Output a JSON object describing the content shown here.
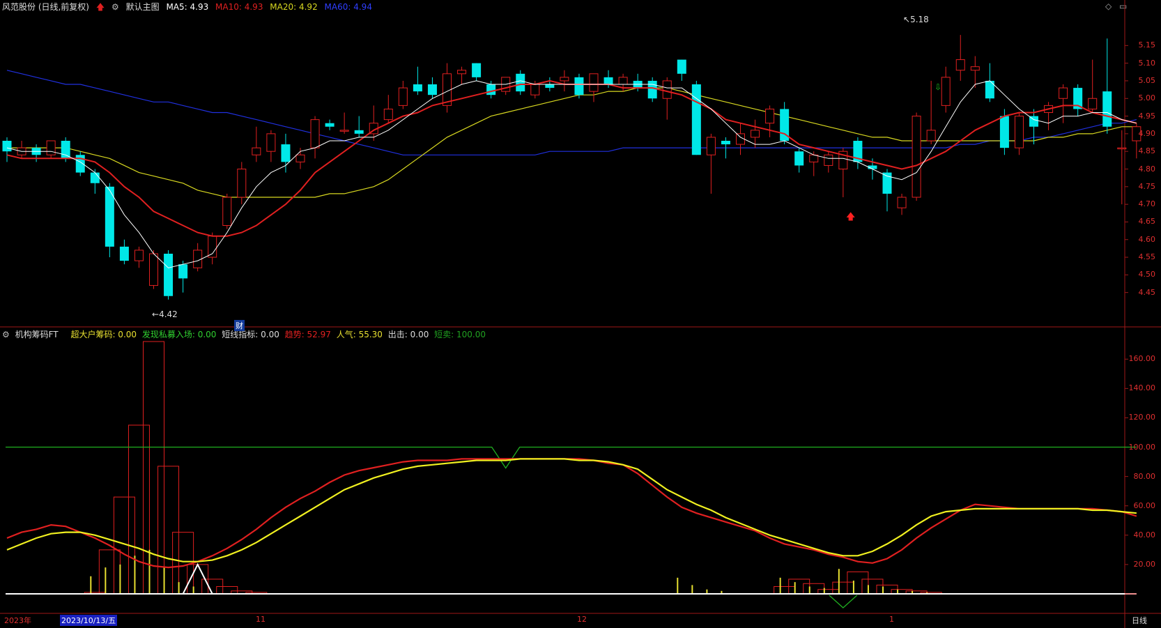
{
  "main_header": {
    "stock": "风范股份 (日线,前复权)",
    "arrow_icon": "up-arrow-icon",
    "settings_icon": "gear-icon",
    "main_chart_label": "默认主图",
    "ma5": "MA5: 4.93",
    "ma10": "MA10: 4.93",
    "ma20": "MA20: 4.92",
    "ma60": "MA60: 4.94"
  },
  "indicator_header": {
    "name": "机构筹码FT",
    "items": [
      {
        "text": "超大户筹码: 0.00",
        "color": "#e8e030"
      },
      {
        "text": "发现私募入场: 0.00",
        "color": "#30d030"
      },
      {
        "text": "短线指标: 0.00",
        "color": "#dddddd"
      },
      {
        "text": "趋势: 52.97",
        "color": "#e02020"
      },
      {
        "text": "人气: 55.30",
        "color": "#e8e030"
      },
      {
        "text": "出击: 0.00",
        "color": "#dddddd"
      },
      {
        "text": "短卖: 100.00",
        "color": "#20a020"
      }
    ]
  },
  "annotations": {
    "high": "5.18",
    "low": "4.42",
    "caiwu": "财"
  },
  "x_axis": {
    "year": "2023年",
    "cursor_date": "2023/10/13/五",
    "m11": "11",
    "m12": "12",
    "m1": "1",
    "period": "日线"
  },
  "colors": {
    "up": "#e02020",
    "down": "#00e8e8",
    "ma5": "#ffffff",
    "ma10": "#e02020",
    "ma20": "#d8d820",
    "ma60": "#2030e0"
  },
  "chart_data": [
    {
      "type": "candlestick",
      "title": "风范股份 (日线,前复权)",
      "y_ticks": [
        "5.15",
        "5.10",
        "5.05",
        "5.00",
        "4.95",
        "4.90",
        "4.85",
        "4.80",
        "4.75",
        "4.70",
        "4.65",
        "4.60",
        "4.55",
        "4.50",
        "4.45"
      ],
      "ylim": [
        4.4,
        5.2
      ],
      "candles": [
        [
          4.88,
          4.85,
          4.89,
          4.82
        ],
        [
          4.84,
          4.86,
          4.88,
          4.83
        ],
        [
          4.86,
          4.84,
          4.87,
          4.82
        ],
        [
          4.84,
          4.88,
          4.88,
          4.83
        ],
        [
          4.88,
          4.83,
          4.89,
          4.82
        ],
        [
          4.84,
          4.79,
          4.85,
          4.78
        ],
        [
          4.79,
          4.76,
          4.8,
          4.73
        ],
        [
          4.75,
          4.58,
          4.76,
          4.55
        ],
        [
          4.58,
          4.54,
          4.6,
          4.53
        ],
        [
          4.54,
          4.57,
          4.58,
          4.52
        ],
        [
          4.47,
          4.56,
          4.57,
          4.46
        ],
        [
          4.56,
          4.44,
          4.57,
          4.43
        ],
        [
          4.53,
          4.49,
          4.54,
          4.45
        ],
        [
          4.52,
          4.57,
          4.59,
          4.51
        ],
        [
          4.55,
          4.61,
          4.62,
          4.53
        ],
        [
          4.64,
          4.72,
          4.73,
          4.63
        ],
        [
          4.72,
          4.8,
          4.82,
          4.7
        ],
        [
          4.84,
          4.86,
          4.92,
          4.82
        ],
        [
          4.85,
          4.9,
          4.91,
          4.82
        ],
        [
          4.87,
          4.82,
          4.9,
          4.79
        ],
        [
          4.82,
          4.84,
          4.86,
          4.8
        ],
        [
          4.86,
          4.94,
          4.95,
          4.83
        ],
        [
          4.93,
          4.92,
          4.94,
          4.91
        ],
        [
          4.91,
          4.91,
          4.96,
          4.9
        ],
        [
          4.91,
          4.9,
          4.95,
          4.89
        ],
        [
          4.9,
          4.93,
          4.98,
          4.88
        ],
        [
          4.94,
          4.97,
          5.01,
          4.93
        ],
        [
          4.98,
          5.03,
          5.05,
          4.97
        ],
        [
          5.04,
          5.02,
          5.09,
          5.01
        ],
        [
          5.04,
          5.01,
          5.06,
          5.0
        ],
        [
          4.98,
          5.07,
          5.1,
          4.96
        ],
        [
          5.07,
          5.08,
          5.09,
          5.04
        ],
        [
          5.1,
          5.06,
          5.1,
          5.05
        ],
        [
          5.04,
          5.01,
          5.05,
          5.0
        ],
        [
          5.02,
          5.06,
          5.06,
          5.01
        ],
        [
          5.07,
          5.02,
          5.08,
          5.01
        ],
        [
          5.01,
          5.04,
          5.05,
          5.0
        ],
        [
          5.04,
          5.03,
          5.06,
          5.02
        ],
        [
          5.05,
          5.06,
          5.08,
          5.02
        ],
        [
          5.06,
          5.01,
          5.07,
          5.0
        ],
        [
          5.02,
          5.07,
          5.07,
          4.99
        ],
        [
          5.06,
          5.04,
          5.08,
          5.03
        ],
        [
          5.04,
          5.06,
          5.07,
          5.02
        ],
        [
          5.05,
          5.03,
          5.07,
          5.02
        ],
        [
          5.05,
          5.0,
          5.06,
          4.99
        ],
        [
          5.0,
          5.05,
          5.06,
          4.94
        ],
        [
          5.11,
          5.07,
          5.11,
          5.05
        ],
        [
          5.04,
          4.84,
          5.05,
          4.84
        ],
        [
          4.84,
          4.89,
          4.9,
          4.73
        ],
        [
          4.88,
          4.87,
          4.89,
          4.83
        ],
        [
          4.87,
          4.9,
          4.93,
          4.84
        ],
        [
          4.89,
          4.91,
          4.94,
          4.86
        ],
        [
          4.93,
          4.97,
          4.98,
          4.89
        ],
        [
          4.97,
          4.88,
          4.99,
          4.87
        ],
        [
          4.85,
          4.81,
          4.86,
          4.79
        ],
        [
          4.82,
          4.84,
          4.85,
          4.78
        ],
        [
          4.81,
          4.84,
          4.85,
          4.79
        ],
        [
          4.8,
          4.85,
          4.86,
          4.72
        ],
        [
          4.88,
          4.82,
          4.89,
          4.8
        ],
        [
          4.81,
          4.8,
          4.83,
          4.77
        ],
        [
          4.79,
          4.73,
          4.8,
          4.68
        ],
        [
          4.69,
          4.72,
          4.73,
          4.67
        ],
        [
          4.72,
          4.95,
          4.96,
          4.71
        ],
        [
          4.88,
          4.91,
          5.05,
          4.87
        ],
        [
          4.98,
          5.06,
          5.09,
          4.96
        ],
        [
          5.08,
          5.11,
          5.18,
          5.05
        ],
        [
          5.08,
          5.09,
          5.12,
          5.03
        ],
        [
          5.05,
          5.0,
          5.1,
          4.99
        ],
        [
          4.95,
          4.86,
          4.97,
          4.84
        ],
        [
          4.86,
          4.95,
          4.96,
          4.84
        ],
        [
          4.95,
          4.92,
          4.97,
          4.87
        ],
        [
          4.96,
          4.98,
          4.99,
          4.91
        ],
        [
          5.0,
          5.03,
          5.04,
          4.93
        ],
        [
          5.03,
          4.97,
          5.04,
          4.95
        ],
        [
          4.97,
          5.0,
          5.11,
          4.96
        ],
        [
          5.02,
          4.92,
          5.17,
          4.9
        ],
        [
          4.86,
          4.86,
          4.91,
          4.7
        ],
        [
          4.88,
          4.92,
          4.93,
          4.83
        ]
      ],
      "ma5": [
        4.86,
        4.85,
        4.85,
        4.85,
        4.84,
        4.82,
        4.79,
        4.74,
        4.67,
        4.62,
        4.56,
        4.52,
        4.53,
        4.54,
        4.56,
        4.62,
        4.69,
        4.75,
        4.79,
        4.81,
        4.85,
        4.86,
        4.88,
        4.88,
        4.89,
        4.89,
        4.91,
        4.94,
        4.97,
        5.0,
        5.02,
        5.04,
        5.05,
        5.04,
        5.04,
        5.05,
        5.04,
        5.04,
        5.04,
        5.04,
        5.04,
        5.04,
        5.04,
        5.04,
        5.04,
        5.03,
        5.03,
        5.0,
        4.97,
        4.93,
        4.89,
        4.87,
        4.87,
        4.88,
        4.86,
        4.84,
        4.83,
        4.83,
        4.82,
        4.8,
        4.78,
        4.77,
        4.79,
        4.85,
        4.92,
        4.99,
        5.04,
        5.05,
        5.01,
        4.97,
        4.94,
        4.93,
        4.95,
        4.95,
        4.96,
        4.96,
        4.94,
        4.93
      ],
      "ma10": [
        4.84,
        4.83,
        4.83,
        4.83,
        4.83,
        4.83,
        4.82,
        4.79,
        4.75,
        4.72,
        4.68,
        4.66,
        4.64,
        4.62,
        4.61,
        4.61,
        4.62,
        4.64,
        4.67,
        4.7,
        4.74,
        4.79,
        4.82,
        4.85,
        4.88,
        4.91,
        4.93,
        4.95,
        4.96,
        4.98,
        4.99,
        5.0,
        5.01,
        5.02,
        5.03,
        5.04,
        5.04,
        5.05,
        5.04,
        5.04,
        5.04,
        5.04,
        5.03,
        5.03,
        5.03,
        5.02,
        5.01,
        4.99,
        4.97,
        4.94,
        4.93,
        4.92,
        4.91,
        4.9,
        4.87,
        4.86,
        4.85,
        4.84,
        4.83,
        4.82,
        4.81,
        4.8,
        4.81,
        4.83,
        4.85,
        4.88,
        4.91,
        4.93,
        4.95,
        4.96,
        4.96,
        4.97,
        4.98,
        4.98,
        4.96,
        4.95,
        4.94,
        4.93
      ],
      "ma20": [
        4.86,
        4.86,
        4.86,
        4.86,
        4.86,
        4.85,
        4.84,
        4.83,
        4.81,
        4.79,
        4.78,
        4.77,
        4.76,
        4.74,
        4.73,
        4.72,
        4.72,
        4.72,
        4.72,
        4.72,
        4.72,
        4.72,
        4.73,
        4.73,
        4.74,
        4.75,
        4.77,
        4.8,
        4.83,
        4.86,
        4.89,
        4.91,
        4.93,
        4.95,
        4.96,
        4.97,
        4.98,
        4.99,
        5.0,
        5.01,
        5.01,
        5.02,
        5.02,
        5.03,
        5.03,
        5.03,
        5.02,
        5.01,
        5.0,
        4.99,
        4.98,
        4.97,
        4.96,
        4.95,
        4.94,
        4.93,
        4.92,
        4.91,
        4.9,
        4.89,
        4.89,
        4.88,
        4.88,
        4.88,
        4.88,
        4.88,
        4.88,
        4.88,
        4.88,
        4.88,
        4.88,
        4.89,
        4.89,
        4.9,
        4.9,
        4.91,
        4.92,
        4.92
      ],
      "ma60": [
        5.08,
        5.07,
        5.06,
        5.05,
        5.04,
        5.04,
        5.03,
        5.02,
        5.01,
        5.0,
        4.99,
        4.99,
        4.98,
        4.97,
        4.96,
        4.96,
        4.95,
        4.94,
        4.93,
        4.92,
        4.91,
        4.9,
        4.89,
        4.88,
        4.87,
        4.86,
        4.85,
        4.84,
        4.84,
        4.84,
        4.84,
        4.84,
        4.84,
        4.84,
        4.84,
        4.84,
        4.84,
        4.85,
        4.85,
        4.85,
        4.85,
        4.85,
        4.86,
        4.86,
        4.86,
        4.86,
        4.86,
        4.86,
        4.86,
        4.86,
        4.86,
        4.86,
        4.86,
        4.86,
        4.86,
        4.86,
        4.86,
        4.86,
        4.86,
        4.86,
        4.86,
        4.86,
        4.86,
        4.86,
        4.86,
        4.87,
        4.87,
        4.88,
        4.88,
        4.88,
        4.89,
        4.89,
        4.9,
        4.91,
        4.92,
        4.93,
        4.93,
        4.94
      ]
    },
    {
      "type": "line",
      "title": "机构筹码FT",
      "y_ticks": [
        "160.00",
        "140.00",
        "120.00",
        "100.00",
        "80.00",
        "60.00",
        "40.00",
        "20.00"
      ],
      "ylim": [
        0,
        172
      ],
      "trend_red": [
        38,
        42,
        44,
        47,
        46,
        42,
        38,
        33,
        27,
        22,
        19,
        18,
        19,
        22,
        26,
        31,
        37,
        44,
        52,
        59,
        65,
        70,
        76,
        81,
        84,
        86,
        88,
        90,
        91,
        91,
        91,
        92,
        92,
        92,
        92,
        92,
        92,
        92,
        92,
        92,
        91,
        89,
        88,
        82,
        74,
        66,
        59,
        55,
        52,
        49,
        46,
        43,
        38,
        34,
        32,
        30,
        27,
        25,
        22,
        21,
        24,
        30,
        38,
        45,
        51,
        57,
        61,
        60,
        59,
        58,
        58,
        58,
        58,
        58,
        58,
        57,
        56,
        53
      ],
      "popularity_yellow": [
        30,
        34,
        38,
        41,
        42,
        42,
        40,
        37,
        34,
        31,
        27,
        24,
        22,
        22,
        23,
        26,
        30,
        35,
        41,
        47,
        53,
        59,
        65,
        71,
        75,
        79,
        82,
        85,
        87,
        88,
        89,
        90,
        91,
        91,
        91,
        92,
        92,
        92,
        92,
        91,
        91,
        90,
        88,
        85,
        78,
        71,
        66,
        61,
        57,
        52,
        48,
        44,
        40,
        37,
        34,
        31,
        28,
        26,
        26,
        29,
        34,
        40,
        47,
        53,
        56,
        57,
        58,
        58,
        58,
        58,
        58,
        58,
        58,
        58,
        57,
        57,
        56,
        55
      ],
      "short_sell_green": 100,
      "red_boxes": [
        [
          6,
          1
        ],
        [
          7,
          30
        ],
        [
          8,
          66
        ],
        [
          9,
          115
        ],
        [
          10,
          172
        ],
        [
          11,
          87
        ],
        [
          12,
          42
        ],
        [
          13,
          20
        ],
        [
          14,
          10
        ],
        [
          15,
          5
        ],
        [
          16,
          2
        ],
        [
          17,
          1
        ],
        [
          53,
          5
        ],
        [
          54,
          10
        ],
        [
          55,
          7
        ],
        [
          56,
          3
        ],
        [
          57,
          8
        ],
        [
          58,
          15
        ],
        [
          59,
          10
        ],
        [
          60,
          6
        ],
        [
          61,
          3
        ],
        [
          62,
          2
        ],
        [
          63,
          1
        ]
      ],
      "yellow_bars": [
        [
          6,
          12
        ],
        [
          7,
          18
        ],
        [
          8,
          20
        ],
        [
          9,
          26
        ],
        [
          10,
          30
        ],
        [
          11,
          18
        ],
        [
          12,
          8
        ],
        [
          13,
          5
        ],
        [
          46,
          11
        ],
        [
          47,
          6
        ],
        [
          48,
          3
        ],
        [
          49,
          2
        ],
        [
          53,
          11
        ],
        [
          54,
          8
        ],
        [
          55,
          5
        ],
        [
          56,
          4
        ],
        [
          57,
          17
        ],
        [
          58,
          9
        ],
        [
          59,
          6
        ],
        [
          60,
          5
        ],
        [
          61,
          3
        ],
        [
          62,
          2
        ],
        [
          63,
          1
        ]
      ],
      "white_peak": [
        12,
        13,
        14
      ],
      "green_dip": [
        34,
        57
      ]
    }
  ]
}
